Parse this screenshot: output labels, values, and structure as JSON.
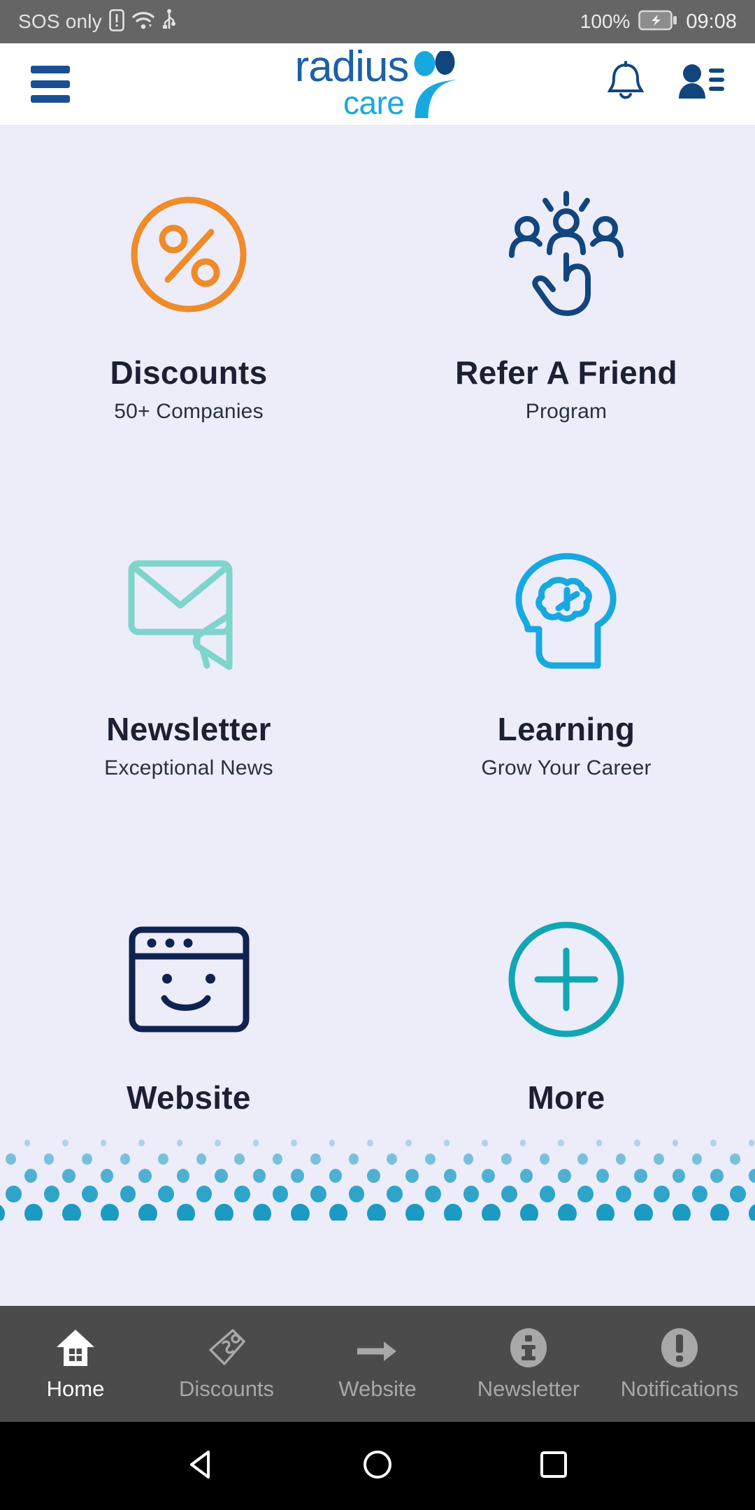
{
  "statusbar": {
    "carrier": "SOS only",
    "battery_pct": "100%",
    "time": "09:08",
    "icons": [
      "sim-alert-icon",
      "wifi-icon",
      "usb-icon",
      "battery-charging-icon"
    ]
  },
  "header": {
    "menu_icon": "hamburger-menu-icon",
    "logo_primary": "radius",
    "logo_secondary": "care",
    "logo_mark": "two-people-icon",
    "bell_icon": "notification-bell-icon",
    "contacts_icon": "contacts-icon"
  },
  "colors": {
    "background": "#ecedf9",
    "logo_blue": "#1d5fa8",
    "logo_cyan": "#17a8e0",
    "discounts_orange": "#ef8b28",
    "refer_navy": "#12457e",
    "newsletter_mint": "#7fd4cc",
    "learning_cyan": "#17a8e0",
    "website_navy": "#0f2350",
    "more_teal": "#12a6b5",
    "dot_blue": "#1b9bc4",
    "nav_bar": "#4b4b4b",
    "status_bar": "#656565",
    "title_text": "#1c2033"
  },
  "tiles": [
    {
      "title": "Discounts",
      "subtitle": "50+ Companies",
      "icon": "percent-circle-icon"
    },
    {
      "title": "Refer A Friend",
      "subtitle": "Program",
      "icon": "refer-friend-icon"
    },
    {
      "title": "Newsletter",
      "subtitle": "Exceptional News",
      "icon": "envelope-megaphone-icon"
    },
    {
      "title": "Learning",
      "subtitle": "Grow Your Career",
      "icon": "head-brain-icon"
    },
    {
      "title": "Website",
      "subtitle": "",
      "icon": "browser-smile-icon"
    },
    {
      "title": "More",
      "subtitle": "",
      "icon": "plus-circle-icon"
    }
  ],
  "bottomnav": {
    "items": [
      {
        "label": "Home",
        "icon": "home-icon",
        "active": true
      },
      {
        "label": "Discounts",
        "icon": "price-tag-icon",
        "active": false
      },
      {
        "label": "Website",
        "icon": "arrow-right-icon",
        "active": false
      },
      {
        "label": "Newsletter",
        "icon": "info-circle-icon",
        "active": false
      },
      {
        "label": "Notifications",
        "icon": "alert-circle-icon",
        "active": false
      }
    ]
  },
  "sysbar": {
    "back": "triangle-back-icon",
    "home": "circle-home-icon",
    "recents": "square-recents-icon"
  }
}
